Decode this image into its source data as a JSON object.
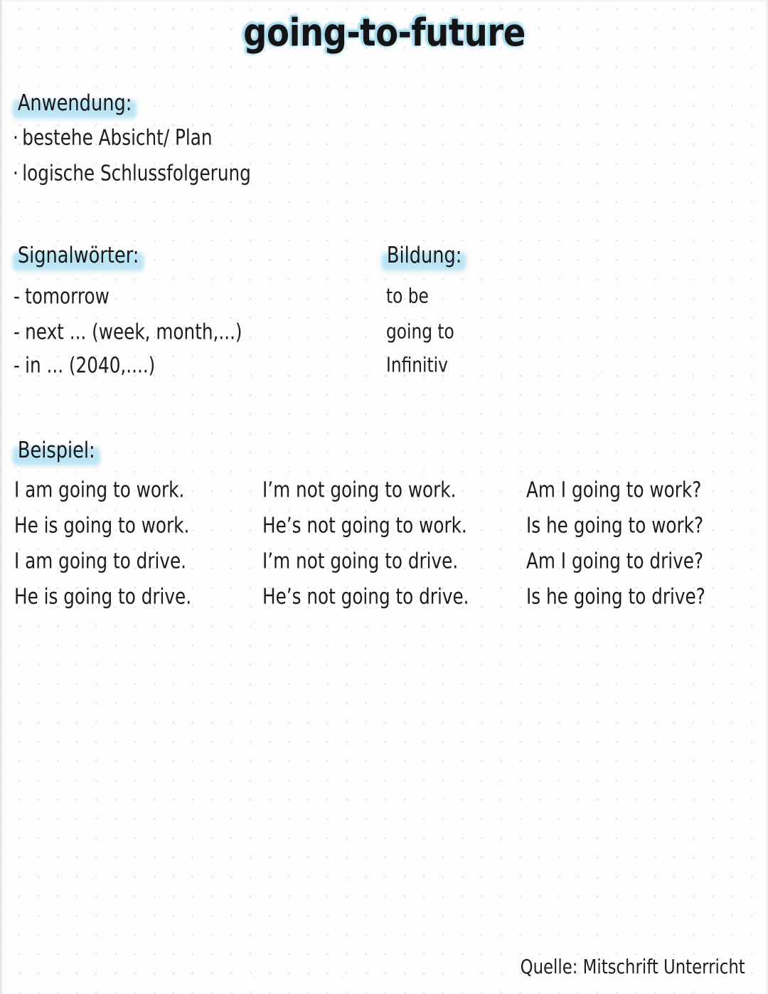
{
  "page": {
    "title": "going-to-future",
    "paper_style": "dot-grid",
    "dot_color": "#e4e4e6",
    "highlight_color": "#b6e3f3",
    "ink_color": "#1d1d1f",
    "title_glow_color": "#a8dcec"
  },
  "sections": {
    "anwendung": {
      "heading": "Anwendung:",
      "bullet_marker": "·",
      "items": [
        "bestehe Absicht/ Plan",
        "logische Schlussfolgerung"
      ]
    },
    "signalwoerter": {
      "heading": "Signalwörter:",
      "bullet_marker": "-",
      "items": [
        "tomorrow",
        "next ... (week, month,...)",
        "in ... (2040,....)"
      ]
    },
    "bildung": {
      "heading": "Bildung:",
      "items": [
        "to be",
        "going to",
        "Infinitiv"
      ]
    },
    "beispiel": {
      "heading": "Beispiel:",
      "columns": {
        "affirmative": [
          "I am going to work.",
          "He is going to work.",
          "I am going to drive.",
          "He is going to drive."
        ],
        "negative": [
          "I’m not going to work.",
          "He’s not going to work.",
          "I’m not going to drive.",
          "He’s not going to drive."
        ],
        "question": [
          "Am I going to work?",
          "Is he going to work?",
          "Am I going to drive?",
          "Is he going to drive?"
        ]
      }
    }
  },
  "footer": {
    "source": "Quelle: Mitschrift Unterricht"
  }
}
